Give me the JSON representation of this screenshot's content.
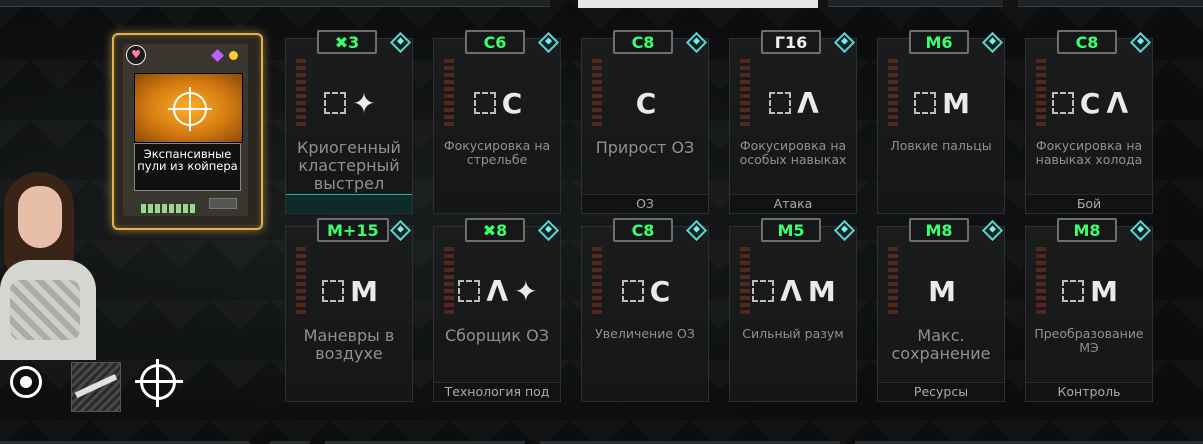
{
  "featured_card": {
    "name": "Экспансивные пули из койпера"
  },
  "cards": [
    {
      "badge": "✖3",
      "badge_color": "green",
      "glyphs": [
        "slot",
        "✦"
      ],
      "title": "Криогенный кластерный выстрел",
      "title_size": "big",
      "footer": "",
      "style": "teal"
    },
    {
      "badge": "C6",
      "badge_color": "green",
      "glyphs": [
        "slot",
        "C"
      ],
      "title": "Фокусировка на стрельбе",
      "title_size": "small",
      "footer": "",
      "style": ""
    },
    {
      "badge": "C8",
      "badge_color": "green",
      "glyphs": [
        "C"
      ],
      "title": "Прирост ОЗ",
      "title_size": "big",
      "footer": "ОЗ",
      "style": ""
    },
    {
      "badge": "Γ16",
      "badge_color": "white",
      "glyphs": [
        "slot",
        "Λ"
      ],
      "title": "Фокусировка на особых навыках",
      "title_size": "small",
      "footer": "Атака",
      "style": ""
    },
    {
      "badge": "M6",
      "badge_color": "green",
      "glyphs": [
        "slot",
        "M"
      ],
      "title": "Ловкие пальцы",
      "title_size": "small",
      "footer": "",
      "style": ""
    },
    {
      "badge": "C8",
      "badge_color": "green",
      "glyphs": [
        "slot",
        "C",
        "Λ"
      ],
      "title": "Фокусировка на навыках холода",
      "title_size": "small",
      "footer": "Бой",
      "style": ""
    },
    {
      "badge": "M+15",
      "badge_color": "green",
      "glyphs": [
        "slot",
        "M"
      ],
      "title": "Маневры в воздухе",
      "title_size": "big",
      "footer": "",
      "style": ""
    },
    {
      "badge": "✖8",
      "badge_color": "green",
      "glyphs": [
        "slot",
        "Λ",
        "✦"
      ],
      "title": "Сборщик ОЗ",
      "title_size": "big",
      "footer": "Технология под",
      "style": ""
    },
    {
      "badge": "C8",
      "badge_color": "green",
      "glyphs": [
        "slot",
        "C"
      ],
      "title": "Увеличение ОЗ",
      "title_size": "small",
      "footer": "",
      "style": ""
    },
    {
      "badge": "M5",
      "badge_color": "green",
      "glyphs": [
        "slot",
        "Λ",
        "M"
      ],
      "title": "Сильный разум",
      "title_size": "small",
      "footer": "",
      "style": ""
    },
    {
      "badge": "M8",
      "badge_color": "green",
      "glyphs": [
        "M"
      ],
      "title": "Макс. сохранение",
      "title_size": "big",
      "footer": "Ресурсы",
      "style": ""
    },
    {
      "badge": "M8",
      "badge_color": "green",
      "glyphs": [
        "slot",
        "M"
      ],
      "title": "Преобразование МЭ",
      "title_size": "small",
      "footer": "Контроль",
      "style": ""
    }
  ],
  "colors": {
    "accent_gold": "#e2b24a",
    "badge_green": "#3cff6e",
    "diamond_teal": "#5fd0d0"
  }
}
